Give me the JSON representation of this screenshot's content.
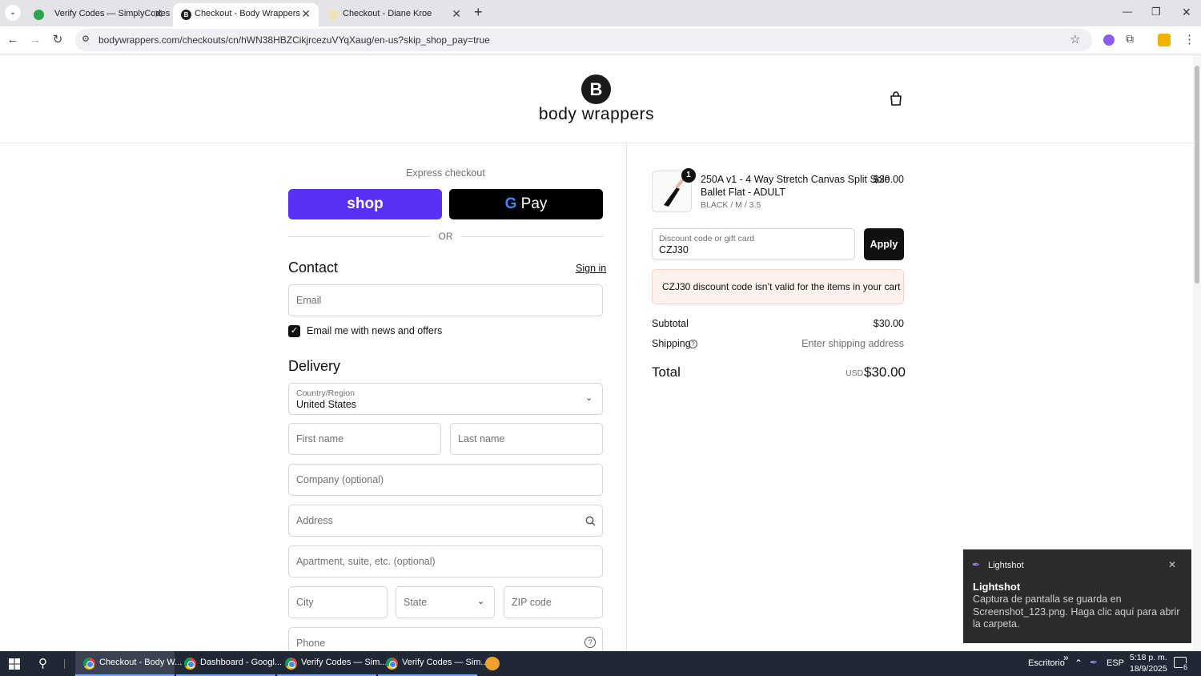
{
  "browser": {
    "tabs": [
      {
        "title": "Verify Codes — SimplyCodes",
        "close": "✕",
        "active": false
      },
      {
        "title": "Checkout - Body Wrappers",
        "close": "✕",
        "active": true
      },
      {
        "title": "Checkout - Diane Kroe",
        "close": "✕",
        "active": false
      }
    ],
    "new_tab": "+",
    "url": "bodywrappers.com/checkouts/cn/hWN38HBZCikjrcezuVYqXaug/en-us?skip_shop_pay=true",
    "window_controls": {
      "minimize": "—",
      "restore": "❐",
      "close": "✕"
    }
  },
  "header": {
    "logo_letter": "B",
    "brand": "body wrappers"
  },
  "express": {
    "title": "Express checkout",
    "shop_label": "shop",
    "gpay_g": "G",
    "gpay_label": "Pay",
    "or": "OR"
  },
  "contact": {
    "title": "Contact",
    "sign_in": "Sign in",
    "email_placeholder": "Email",
    "newsletter_label": "Email me with news and offers",
    "newsletter_checked": true
  },
  "delivery": {
    "title": "Delivery",
    "country_label": "Country/Region",
    "country_value": "United States",
    "first_name": "First name",
    "last_name": "Last name",
    "company": "Company (optional)",
    "address": "Address",
    "apartment": "Apartment, suite, etc. (optional)",
    "city": "City",
    "state": "State",
    "zip": "ZIP code",
    "phone": "Phone"
  },
  "summary": {
    "item": {
      "qty": "1",
      "name_line1": "250A v1 - 4 Way Stretch Canvas Split Sole",
      "name_line2": "Ballet Flat - ADULT",
      "variant": "BLACK / M / 3.5",
      "price": "$30.00"
    },
    "discount_label": "Discount code or gift card",
    "discount_value": "CZJ30",
    "apply": "Apply",
    "error": "CZJ30 discount code isn’t valid for the items in your cart",
    "subtotal_label": "Subtotal",
    "subtotal_value": "$30.00",
    "shipping_label": "Shipping",
    "shipping_value": "Enter shipping address",
    "total_label": "Total",
    "currency": "USD",
    "total_value": "$30.00"
  },
  "toast": {
    "app": "Lightshot",
    "title": "Lightshot",
    "message": "Captura de pantalla se guarda en Screenshot_123.png. Haga clic aquí para abrir la carpeta.",
    "close": "✕"
  },
  "taskbar": {
    "items": [
      {
        "label": "Checkout - Body W..."
      },
      {
        "label": "Dashboard - Googl..."
      },
      {
        "label": "Verify Codes — Sim..."
      },
      {
        "label": "Verify Codes — Sim..."
      }
    ],
    "desktop": "Escritorio",
    "chevron": "»",
    "lang": "ESP",
    "time": "5:18 p. m.",
    "date": "18/9/2025",
    "notif_count": "6"
  },
  "colors": {
    "shop_purple": "#5a31f4",
    "error_bg": "#fff1ec",
    "error_border": "#f7d3c6",
    "dark": "#111111"
  }
}
